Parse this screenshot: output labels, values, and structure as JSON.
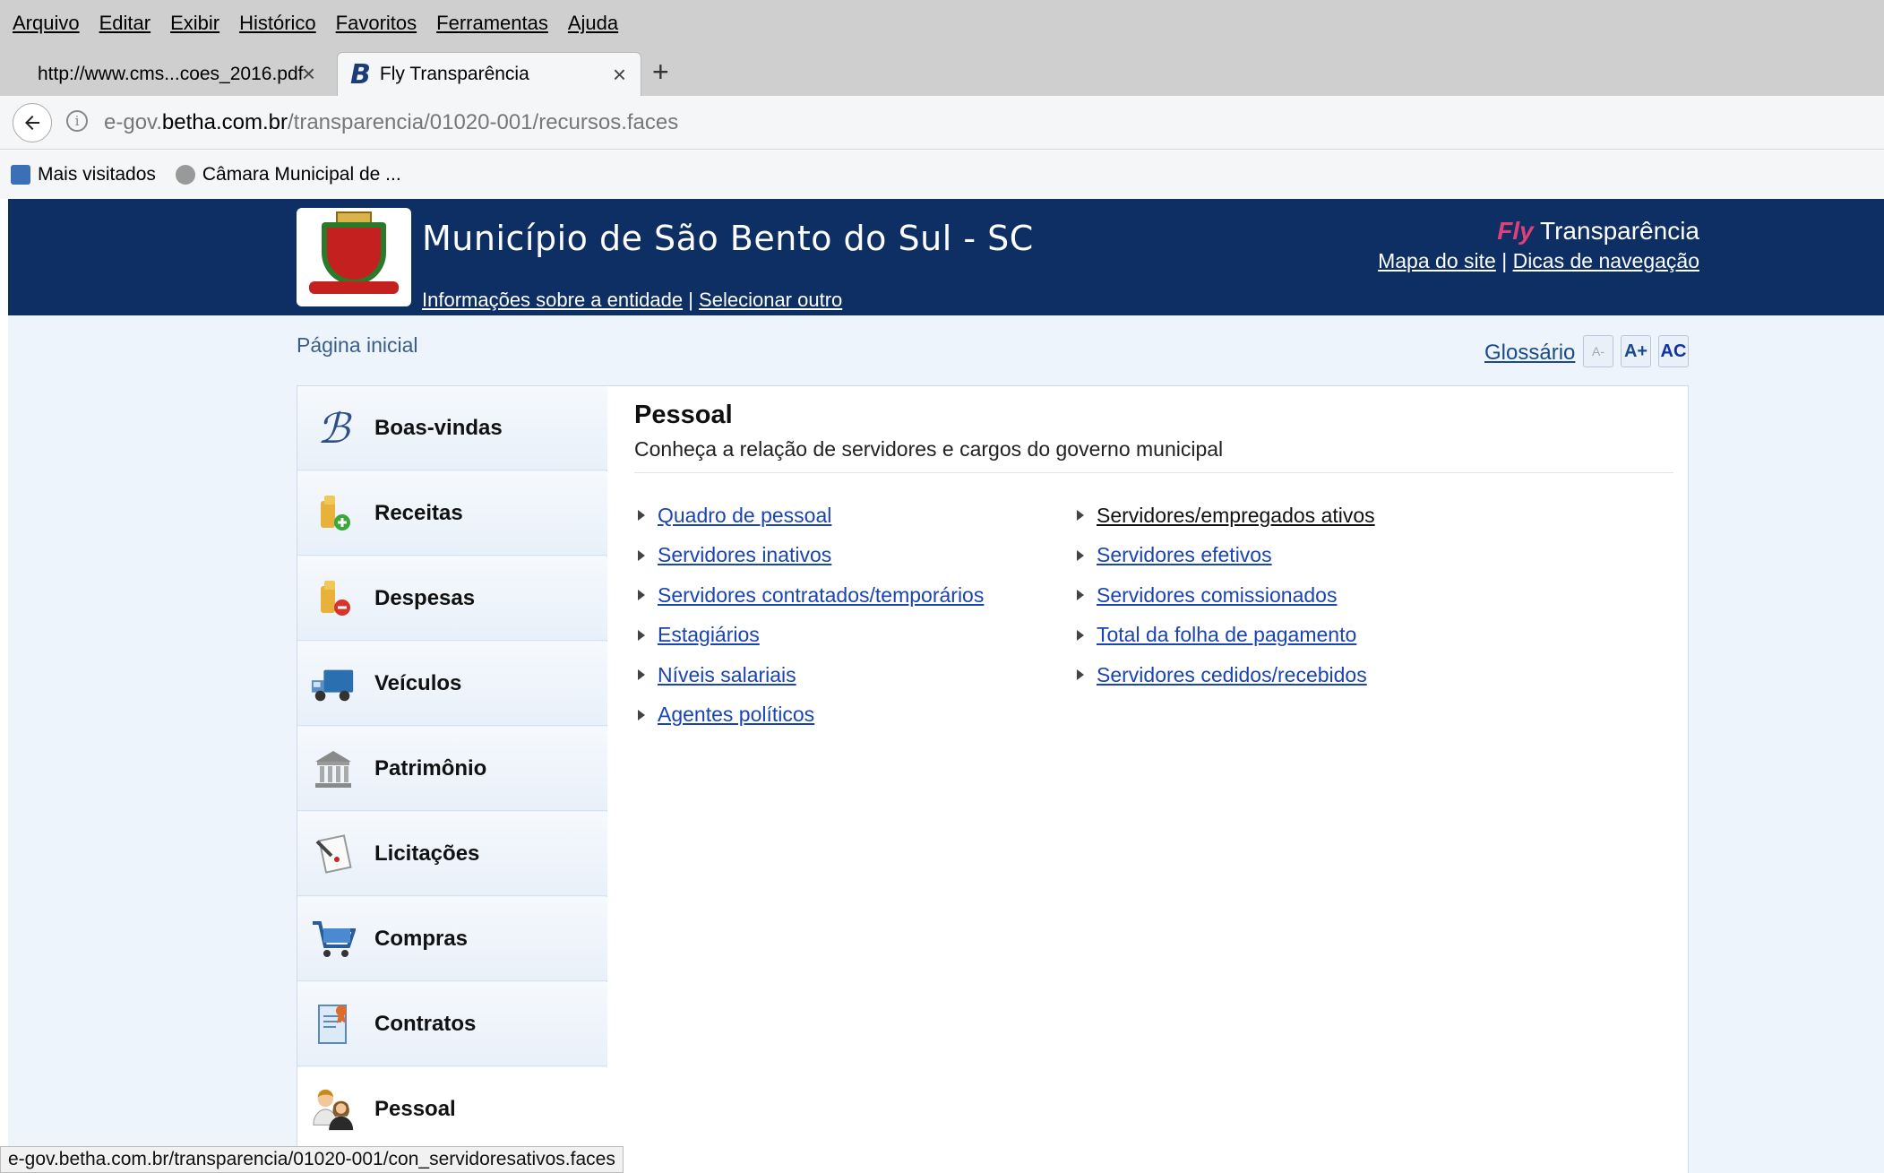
{
  "menu": [
    "Arquivo",
    "Editar",
    "Exibir",
    "Histórico",
    "Favoritos",
    "Ferramentas",
    "Ajuda"
  ],
  "tabs": [
    {
      "title": "http://www.cms...coes_2016.pdf"
    },
    {
      "title": "Fly Transparência",
      "icon": "B"
    }
  ],
  "new_tab": "+",
  "url": {
    "prefix": "e-gov.",
    "domain": "betha.com.br",
    "path": "/transparencia/01020-001/recursos.faces"
  },
  "bookmarks": [
    "Mais visitados",
    "Câmara Municipal de ..."
  ],
  "header": {
    "title": "Município de São Bento do Sul - SC",
    "info_link": "Informações sobre a entidade",
    "separator": "|",
    "select_link": "Selecionar outro",
    "brand_fly": "Fly",
    "brand_name": "Transparência",
    "sitemap": "Mapa do site",
    "nav_tips": "Dicas de navegação"
  },
  "breadcrumb": "Página inicial",
  "tools": {
    "glossary": "Glossário",
    "font_smaller": "A-",
    "font_larger": "A+",
    "contrast": "AC"
  },
  "sidebar": {
    "items": [
      {
        "label": "Boas-vindas"
      },
      {
        "label": "Receitas"
      },
      {
        "label": "Despesas"
      },
      {
        "label": "Veículos"
      },
      {
        "label": "Patrimônio"
      },
      {
        "label": "Licitações"
      },
      {
        "label": "Compras"
      },
      {
        "label": "Contratos"
      },
      {
        "label": "Pessoal"
      }
    ]
  },
  "section": {
    "title": "Pessoal",
    "subtitle": "Conheça a relação de servidores e cargos do governo municipal",
    "col1": [
      "Quadro de pessoal",
      "Servidores inativos",
      "Servidores contratados/temporários",
      "Estagiários",
      "Níveis salariais",
      "Agentes políticos"
    ],
    "col2": [
      "Servidores/empregados ativos",
      "Servidores efetivos",
      "Servidores comissionados",
      "Total da folha de pagamento",
      "Servidores cedidos/recebidos"
    ]
  },
  "status_url": "e-gov.betha.com.br/transparencia/01020-001/con_servidoresativos.faces"
}
